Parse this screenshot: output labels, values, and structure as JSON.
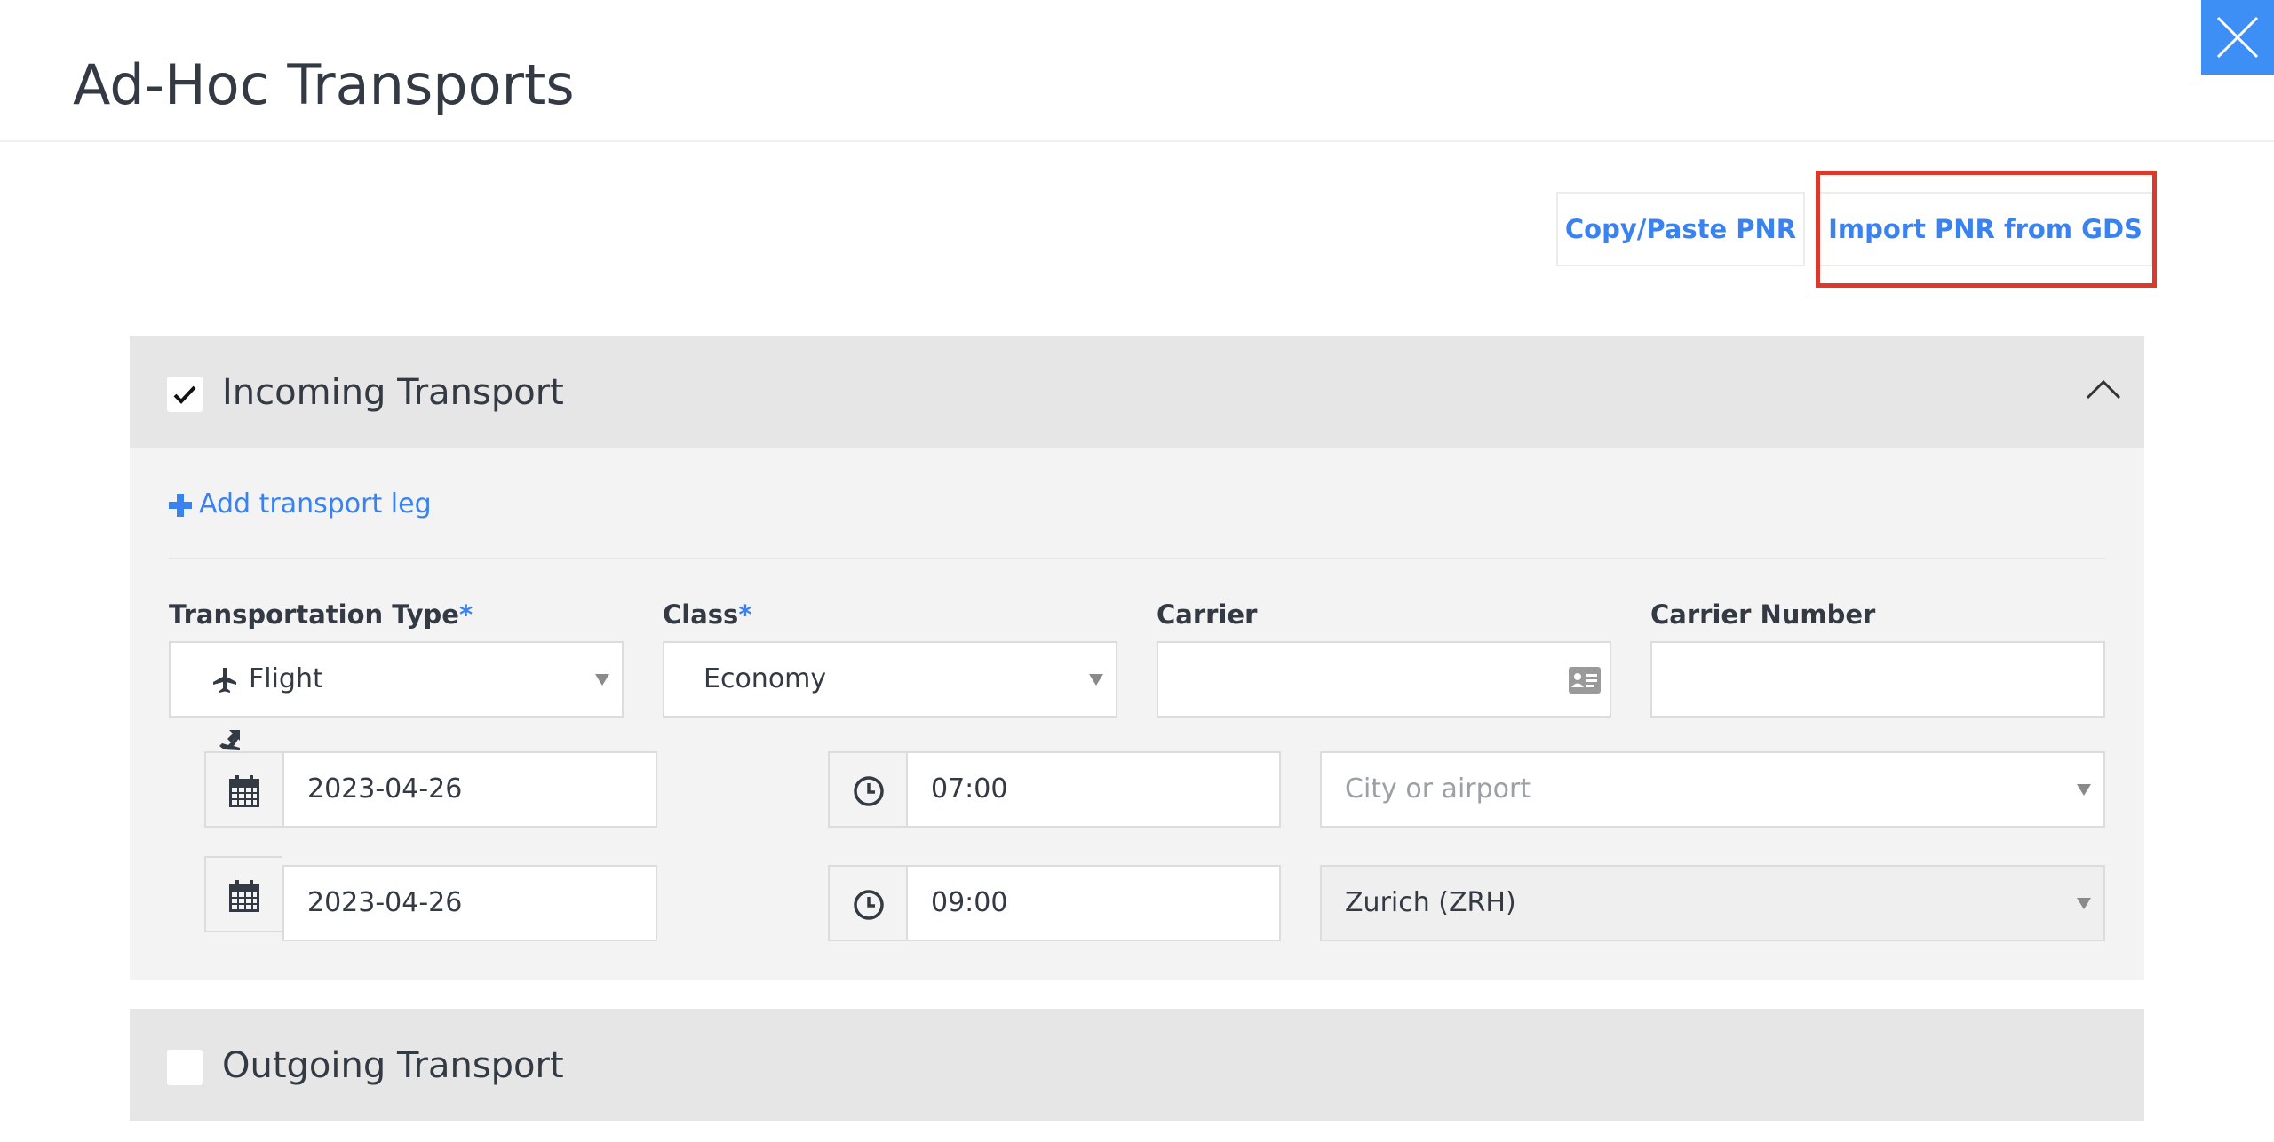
{
  "header": {
    "title": "Ad-Hoc Transports"
  },
  "actions": {
    "copy_paste": "Copy/Paste PNR",
    "import_gds": "Import PNR from GDS"
  },
  "incoming": {
    "title": "Incoming Transport",
    "checked": true,
    "add_leg": "Add transport leg",
    "fields": {
      "transportation_type": {
        "label": "Transportation Type",
        "required": "*",
        "value": "Flight"
      },
      "class": {
        "label": "Class",
        "required": "*",
        "value": "Economy"
      },
      "carrier": {
        "label": "Carrier",
        "value": ""
      },
      "carrier_number": {
        "label": "Carrier Number",
        "value": ""
      }
    },
    "departure": {
      "date": "2023-04-26",
      "time": "07:00",
      "location_placeholder": "City or airport",
      "location": ""
    },
    "arrival": {
      "date": "2023-04-26",
      "time": "09:00",
      "location": "Zurich (ZRH)"
    }
  },
  "outgoing": {
    "title": "Outgoing Transport",
    "checked": false
  },
  "colors": {
    "accent": "#3a82f0",
    "close_bg": "#3d8ef5",
    "highlight": "#d93a2b",
    "panel": "#e6e6e6"
  }
}
